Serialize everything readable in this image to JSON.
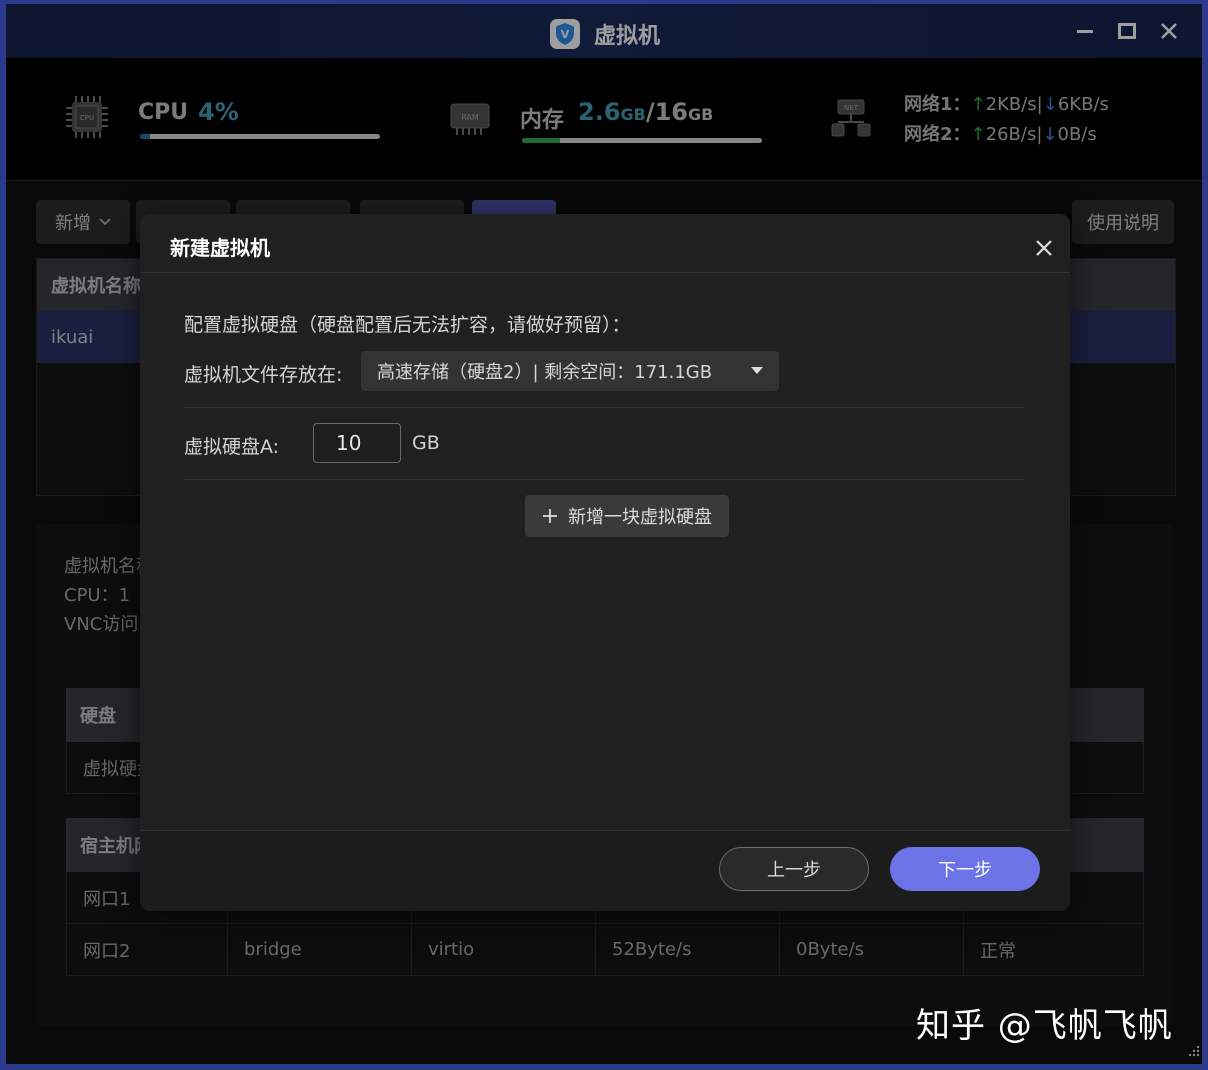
{
  "window": {
    "title": "虚拟机"
  },
  "stats": {
    "cpu": {
      "label": "CPU",
      "value": "4%",
      "usage_fraction": 0.04,
      "icon_text": "CPU"
    },
    "memory": {
      "label": "内存",
      "used": "2.6",
      "used_unit": "GB",
      "separator": "/",
      "total": "16",
      "total_unit": "GB",
      "usage_fraction": 0.16,
      "icon_text": "RAM"
    },
    "network": {
      "icon_text": "NET",
      "net1": {
        "label": "网络1：",
        "up": "2KB/s",
        "sep": "|",
        "down": "6KB/s"
      },
      "net2": {
        "label": "网络2：",
        "up": "26B/s",
        "sep": "|",
        "down": "0B/s"
      }
    }
  },
  "toolbar": {
    "add_label": "新增",
    "help_label": "使用说明"
  },
  "vm_table": {
    "header": "虚拟机名称",
    "row_name": "ikuai"
  },
  "details": {
    "name_label": "虚拟机名称",
    "cpu_label": "CPU：1",
    "vnc_label": "VNC访问"
  },
  "disk_table": {
    "header": "硬盘",
    "row": "虚拟硬盘"
  },
  "host_table": {
    "header": "宿主机网口",
    "rows": [
      [
        "网口1"
      ],
      [
        "网口2",
        "bridge",
        "virtio",
        "52Byte/s",
        "0Byte/s",
        "正常"
      ]
    ]
  },
  "modal": {
    "title": "新建虚拟机",
    "section_label": "配置虚拟硬盘（硬盘配置后无法扩容，请做好预留）：",
    "storage_label": "虚拟机文件存放在:",
    "storage_value": "高速存储（硬盘2）| 剩余空间：171.1GB",
    "disk_a_label": "虚拟硬盘A:",
    "disk_a_value": "10",
    "disk_a_unit": "GB",
    "add_disk_label": "新增一块虚拟硬盘",
    "prev_label": "上一步",
    "next_label": "下一步"
  },
  "watermark": "知乎 @飞帆飞帆",
  "colors": {
    "accent": "#6b73e6",
    "cpu_value": "#4a9fb8",
    "up_arrow": "#2fb34a",
    "down_arrow": "#4a7ff0"
  }
}
